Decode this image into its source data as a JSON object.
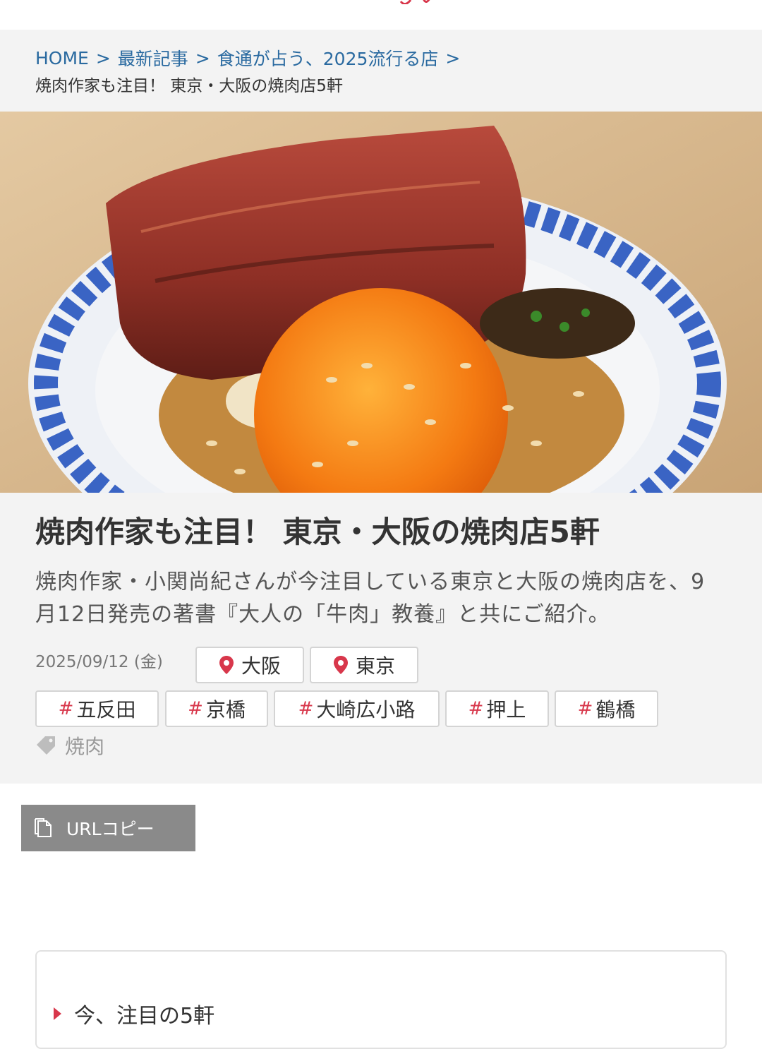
{
  "breadcrumb": {
    "items": [
      {
        "label": "HOME"
      },
      {
        "label": "最新記事"
      },
      {
        "label": "食通が占う、2025流行る店"
      }
    ],
    "separator": ">",
    "current": "焼肉作家も注目！ 東京・大阪の焼肉店5軒"
  },
  "hero": {
    "icon": "grilled-wagyu-with-egg-yolk-photo"
  },
  "article": {
    "title": "焼肉作家も注目！ 東京・大阪の焼肉店5軒",
    "lead_line1": "焼肉作家・小関尚紀さんが今注目している東京と大阪の焼肉店を、9",
    "lead_line2": "月12日発売の著書『大人の「牛肉」教養』と共にご紹介。",
    "date": "2025/09/12 (金)",
    "locations": [
      "大阪",
      "東京"
    ],
    "hashtags": [
      "五反田",
      "京橋",
      "大崎広小路",
      "押上",
      "鶴橋"
    ],
    "hash_symbol": "#",
    "category_tag": "焼肉"
  },
  "share": {
    "copy_label": "URLコピー"
  },
  "toc": {
    "first_item": "今、注目の5軒"
  },
  "colors": {
    "accent": "#d8374b",
    "link": "#2a6aa0",
    "panel": "#f3f3f3",
    "button": "#8a8a8a"
  }
}
